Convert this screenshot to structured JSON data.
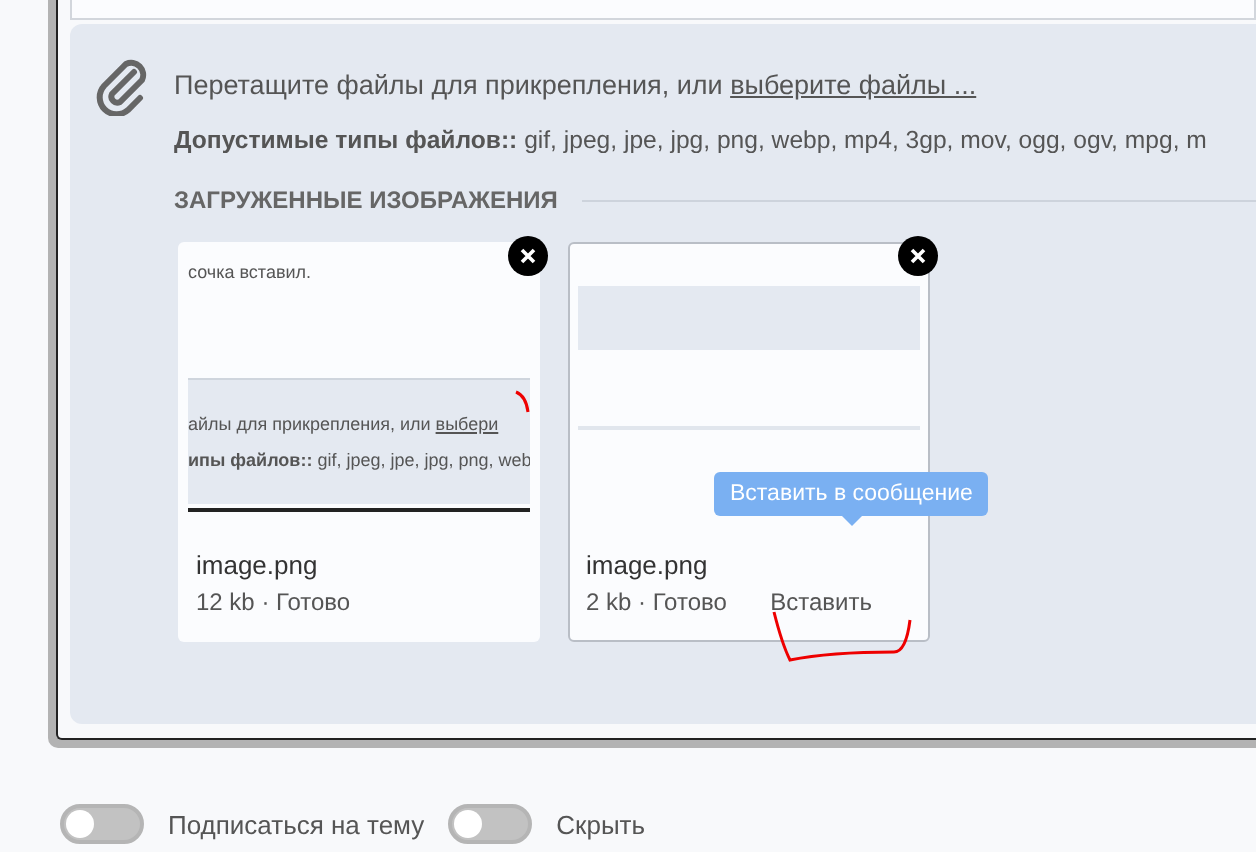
{
  "attachments": {
    "prompt": "Перетащите файлы для прикрепления, или ",
    "link": "выберите файлы ...",
    "allowed": "**Допустимые типы файлов::** gif, jpeg, jpe, jpg, png, webp, mp4, 3gp, mov, ogg, ogv, mpg, m"
  },
  "uploads": {
    "heading": "ЗАГРУЖЕННЫЕ ИЗОБРАЖЕНИЯ",
    "files": [
      {
        "name": "image.png",
        "meta": "12 kb · Готово",
        "preview": {
          "kind": "screenshot",
          "caption": "сочка вставил.",
          "prompt": "айлы для прикрепления, или ",
          "link": "выбери",
          "types": "**ипы файлов::** gif, jpeg, jpe, jpg, png, web"
        }
      },
      {
        "name": "image.png",
        "meta": "2 kb · Готово",
        "preview": {
          "kind": "blank"
        },
        "insert_button": "Вставить",
        "tooltip": "Вставить в сообщение"
      }
    ]
  },
  "toggles": [
    {
      "label": "Подписаться на тему",
      "on": false
    },
    {
      "label": "Скрыть",
      "on": false
    }
  ]
}
